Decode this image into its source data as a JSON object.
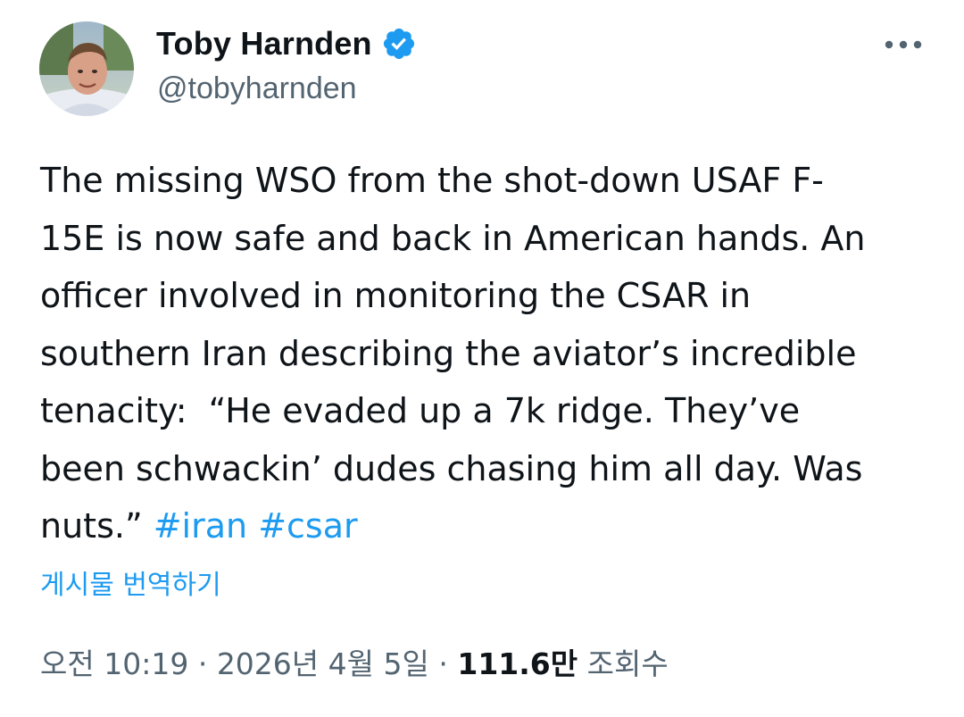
{
  "author": {
    "display_name": "Toby Harnden",
    "handle": "@tobyharnden",
    "verified_icon": "verified-badge-icon",
    "verified_color": "#1d9bf0"
  },
  "more_icon": "more-options-icon",
  "tweet": {
    "text_before": "The missing WSO from the shot-down USAF F-\n15E is now safe and back in American hands. An\nofficer involved in monitoring the CSAR in\nsouthern Iran describing the aviator’s incredible\ntenacity:  “He evaded up a 7k ridge. They’ve\nbeen schwackin’ dudes chasing him all day. Was\nnuts.” ",
    "hashtags": [
      "#iran",
      "#csar"
    ]
  },
  "translate_label": "게시물 번역하기",
  "meta": {
    "time": "오전 10:19",
    "separator": "·",
    "date": "2026년 4월 5일",
    "views_count": "111.6만",
    "views_label": "조회수"
  },
  "colors": {
    "text": "#0f1419",
    "secondary": "#536471",
    "accent": "#1d9bf0"
  }
}
